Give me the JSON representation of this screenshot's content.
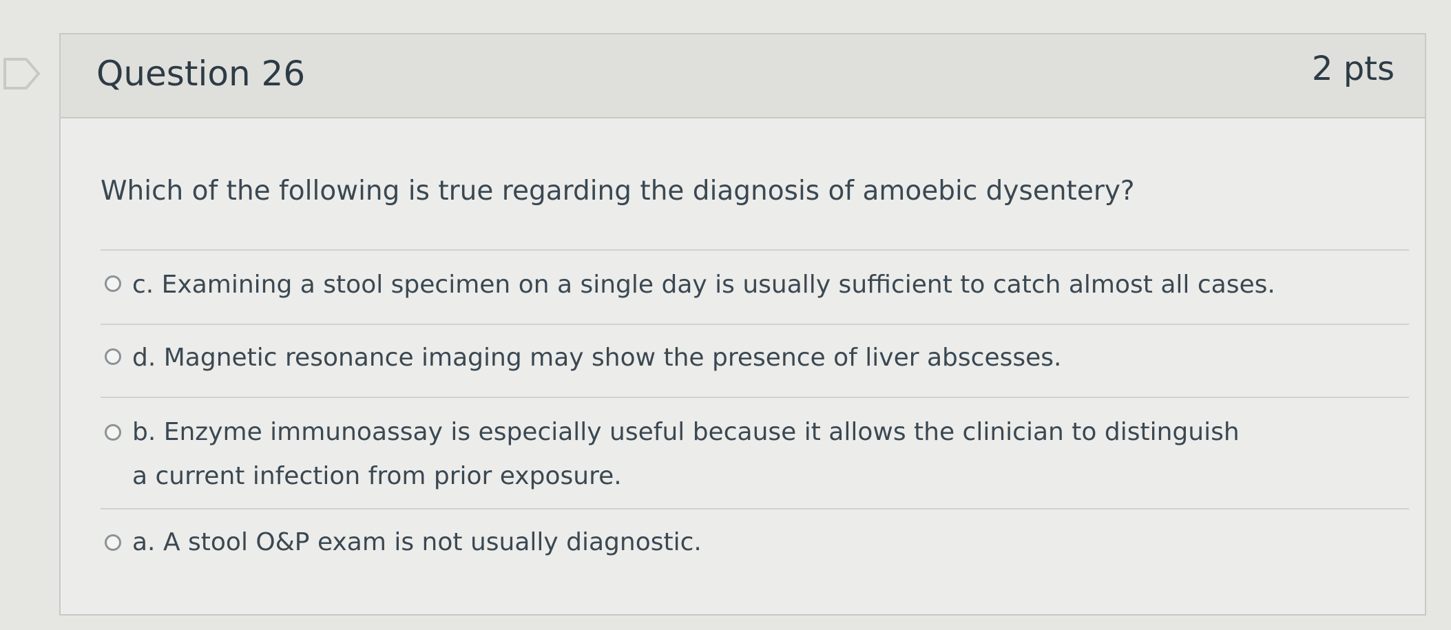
{
  "question": {
    "title": "Question 26",
    "points": "2 pts",
    "text": "Which of the following is true regarding the diagnosis of amoebic dysentery?"
  },
  "answers": [
    {
      "label": "c. Examining a stool specimen on a single day is usually sufficient to catch almost all cases.",
      "selected": false
    },
    {
      "label": "d. Magnetic resonance imaging may show the presence of liver abscesses.",
      "selected": false
    },
    {
      "label": "b. Enzyme immunoassay is especially useful because it allows the clinician to distinguish a current infection from prior exposure.",
      "selected": false
    },
    {
      "label": "a. A stool O&P exam is not usually diagnostic.",
      "selected": false
    }
  ],
  "icons": {
    "flag": "bookmark-flag-icon",
    "radio": "radio-button-icon"
  },
  "colors": {
    "text": "#2d3b45",
    "header_bg": "#dfdfdc",
    "card_bg": "#ececea",
    "border": "#c8c8c5"
  }
}
